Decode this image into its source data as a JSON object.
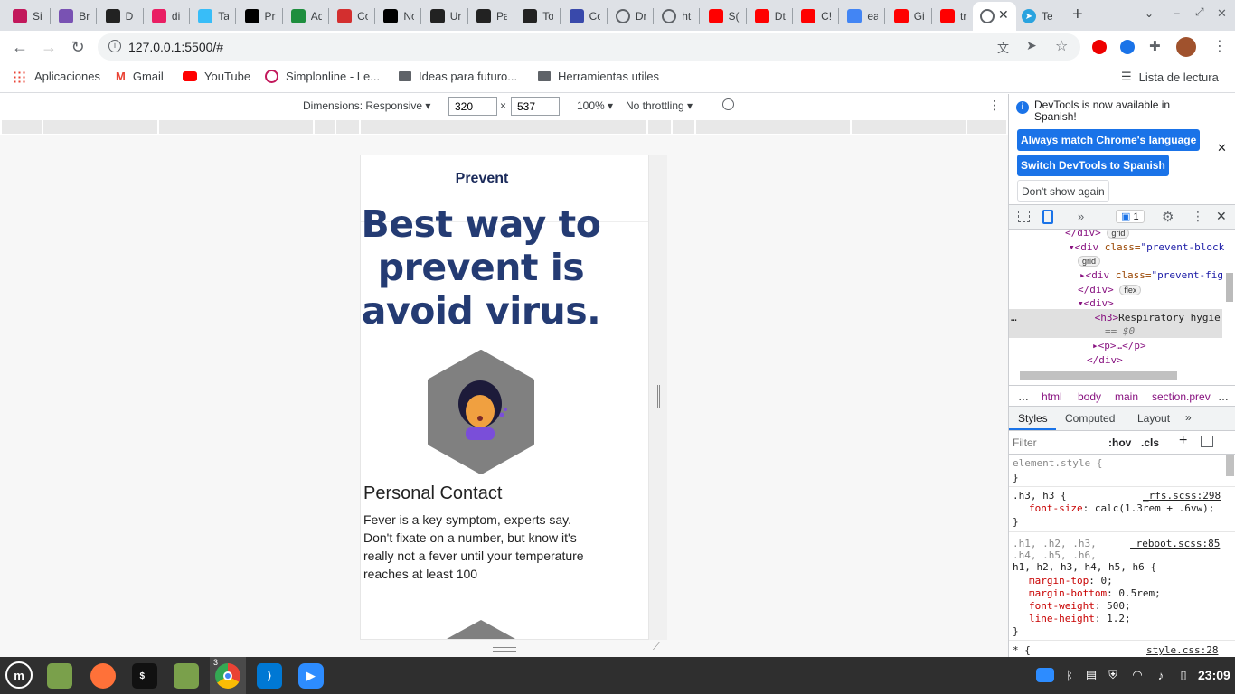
{
  "tabs": [
    {
      "title": "Si",
      "icon": "simplon-icon",
      "color": "#c2185b"
    },
    {
      "title": "Br",
      "icon": "bootstrap-icon",
      "color": "#7952b3"
    },
    {
      "title": "D",
      "icon": "devchallenges-icon",
      "color": "#222"
    },
    {
      "title": "di",
      "icon": "dribbble-like-icon",
      "color": "#e91e63"
    },
    {
      "title": "Ta",
      "icon": "tailwind-icon",
      "color": "#38bdf8"
    },
    {
      "title": "Pr",
      "icon": "pr-icon",
      "color": "#000"
    },
    {
      "title": "Ad",
      "icon": "drive-icon",
      "color": "#1e8e3e"
    },
    {
      "title": "Co",
      "icon": "co-icon",
      "color": "#d32f2f"
    },
    {
      "title": "No",
      "icon": "notion-icon",
      "color": "#000"
    },
    {
      "title": "Ur",
      "icon": "github-icon",
      "color": "#222"
    },
    {
      "title": "Pa",
      "icon": "github-icon",
      "color": "#222"
    },
    {
      "title": "To",
      "icon": "github-icon",
      "color": "#222"
    },
    {
      "title": "Cc",
      "icon": "cc-icon",
      "color": "#3949ab"
    },
    {
      "title": "Dr",
      "icon": "globe-icon",
      "color": "#5f6368"
    },
    {
      "title": "ht",
      "icon": "globe-icon",
      "color": "#5f6368"
    },
    {
      "title": "S(",
      "icon": "youtube-icon",
      "color": "#ff0000"
    },
    {
      "title": "Dt",
      "icon": "youtube-icon",
      "color": "#ff0000"
    },
    {
      "title": "C!",
      "icon": "youtube-icon",
      "color": "#ff0000"
    },
    {
      "title": "ea",
      "icon": "google-icon",
      "color": "#4285f4"
    },
    {
      "title": "Gi",
      "icon": "youtube-icon",
      "color": "#ff0000"
    },
    {
      "title": "tr",
      "icon": "youtube-icon",
      "color": "#ff0000"
    }
  ],
  "active_tab": {
    "icon": "globe-icon"
  },
  "last_tab": {
    "title": "Te",
    "icon": "telegram-icon",
    "color": "#2aa3df"
  },
  "url": "127.0.0.1:5500/#",
  "bookmarks": [
    {
      "label": "Aplicaciones",
      "icon": "apps-grid-icon"
    },
    {
      "label": "Gmail",
      "icon": "gmail-icon"
    },
    {
      "label": "YouTube",
      "icon": "youtube-icon"
    },
    {
      "label": "Simplonline - Le...",
      "icon": "simplon-icon"
    },
    {
      "label": "Ideas para futuro...",
      "icon": "folder-icon"
    },
    {
      "label": "Herramientas utiles",
      "icon": "folder-icon"
    }
  ],
  "reading_list": "Lista de lectura",
  "device": {
    "dimensions": "Dimensions: Responsive",
    "width": "320",
    "height": "537",
    "times": "×",
    "zoom": "100%",
    "throttle": "No throttling"
  },
  "page": {
    "brand": "Prevent",
    "heading": "Best way to prevent is avoid virus.",
    "card_title": "Personal Contact",
    "card_text": "Fever is a key symptom, experts say. Don't fixate on a number, but know it's really not a fever until your temperature reaches at least 100"
  },
  "devtools": {
    "notice": "DevTools is now available in Spanish!",
    "btn_match": "Always match Chrome's language",
    "btn_switch": "Switch DevTools to Spanish",
    "btn_dont": "Don't show again",
    "issues_count": "1",
    "dom": {
      "l1_close": "</div>",
      "l1_badge": "grid",
      "l2_tag": "<div ",
      "l2_attr": "class=",
      "l2_val": "\"prevent-block",
      "l3_badge": "grid",
      "l4_tag": "<div ",
      "l4_attr": "class=",
      "l4_val": "\"prevent-fig",
      "l5_close": "</div>",
      "l5_badge": "flex",
      "l6_tag": "<div>",
      "l7_tag": "<h3>",
      "l7_text": "Respiratory hygie",
      "l8_sel": "== $0",
      "l9_tag": "<p>…</p>",
      "l10_close": "</div>",
      "more": "…"
    },
    "breadcrumbs": [
      "…",
      "html",
      "body",
      "main",
      "section.prev",
      "…"
    ],
    "panes": [
      "Styles",
      "Computed",
      "Layout",
      "»"
    ],
    "filter": "Filter",
    "hov": ":hov",
    "cls": ".cls",
    "rules": [
      {
        "sel": "element.style {",
        "src": "",
        "lines": []
      },
      {
        "sel": ".h3, h3 {",
        "src": "_rfs.scss:298",
        "lines": [
          {
            "p": "font-size",
            "v": "calc(1.3rem + .6vw);"
          }
        ]
      },
      {
        "sel": ".h1, .h2, .h3,",
        "sel2": ".h4, .h5, .h6,",
        "sel3": "h1, h2, h3, h4, h5, h6 {",
        "src": "_reboot.scss:85",
        "lines": [
          {
            "p": "margin-top",
            "v": "0;"
          },
          {
            "p": "margin-bottom",
            "v": "0.5rem;"
          },
          {
            "p": "font-weight",
            "v": "500;"
          },
          {
            "p": "line-height",
            "v": "1.2;"
          }
        ]
      },
      {
        "sel": "* {",
        "src": "style.css:28",
        "lines": []
      }
    ],
    "close_brace": "}"
  },
  "taskbar": {
    "clock": "23:09",
    "chrome_badge": "3"
  }
}
